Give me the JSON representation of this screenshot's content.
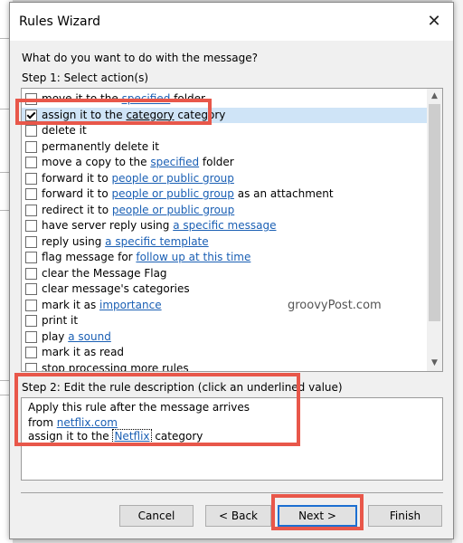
{
  "window": {
    "title": "Rules Wizard"
  },
  "question": "What do you want to do with the message?",
  "step1_label": "Step 1: Select action(s)",
  "actions": [
    {
      "parts": [
        {
          "t": "move it to the "
        },
        {
          "l": "specified"
        },
        {
          "t": " folder"
        }
      ],
      "checked": false,
      "selected": false
    },
    {
      "parts": [
        {
          "t": "assign it to the "
        },
        {
          "l": "category",
          "dark": true
        },
        {
          "t": " category"
        }
      ],
      "checked": true,
      "selected": true
    },
    {
      "parts": [
        {
          "t": "delete it"
        }
      ],
      "checked": false,
      "selected": false
    },
    {
      "parts": [
        {
          "t": "permanently delete it"
        }
      ],
      "checked": false,
      "selected": false
    },
    {
      "parts": [
        {
          "t": "move a copy to the "
        },
        {
          "l": "specified"
        },
        {
          "t": " folder"
        }
      ],
      "checked": false,
      "selected": false
    },
    {
      "parts": [
        {
          "t": "forward it to "
        },
        {
          "l": "people or public group"
        }
      ],
      "checked": false,
      "selected": false
    },
    {
      "parts": [
        {
          "t": "forward it to "
        },
        {
          "l": "people or public group"
        },
        {
          "t": " as an attachment"
        }
      ],
      "checked": false,
      "selected": false
    },
    {
      "parts": [
        {
          "t": "redirect it to "
        },
        {
          "l": "people or public group"
        }
      ],
      "checked": false,
      "selected": false
    },
    {
      "parts": [
        {
          "t": "have server reply using "
        },
        {
          "l": "a specific message"
        }
      ],
      "checked": false,
      "selected": false
    },
    {
      "parts": [
        {
          "t": "reply using "
        },
        {
          "l": "a specific template"
        }
      ],
      "checked": false,
      "selected": false
    },
    {
      "parts": [
        {
          "t": "flag message for "
        },
        {
          "l": "follow up at this time"
        }
      ],
      "checked": false,
      "selected": false
    },
    {
      "parts": [
        {
          "t": "clear the Message Flag"
        }
      ],
      "checked": false,
      "selected": false
    },
    {
      "parts": [
        {
          "t": "clear message's categories"
        }
      ],
      "checked": false,
      "selected": false
    },
    {
      "parts": [
        {
          "t": "mark it as "
        },
        {
          "l": "importance"
        }
      ],
      "checked": false,
      "selected": false
    },
    {
      "parts": [
        {
          "t": "print it"
        }
      ],
      "checked": false,
      "selected": false
    },
    {
      "parts": [
        {
          "t": "play "
        },
        {
          "l": "a sound"
        }
      ],
      "checked": false,
      "selected": false
    },
    {
      "parts": [
        {
          "t": "mark it as read"
        }
      ],
      "checked": false,
      "selected": false
    },
    {
      "parts": [
        {
          "t": "stop processing more rules"
        }
      ],
      "checked": false,
      "selected": false
    }
  ],
  "step2_label": "Step 2: Edit the rule description (click an underlined value)",
  "description": {
    "line1": "Apply this rule after the message arrives",
    "line2_prefix": "from ",
    "line2_link": "netflix.com",
    "line3_prefix": "assign it to the ",
    "line3_link": "Netflix",
    "line3_suffix": " category"
  },
  "buttons": {
    "cancel": "Cancel",
    "back": "< Back",
    "next": "Next >",
    "finish": "Finish"
  },
  "watermark": "groovyPost.com",
  "icons": {
    "close": "close-icon",
    "checkbox": "checkbox-icon",
    "scroll_up": "scroll-up-icon",
    "scroll_down": "scroll-down-icon"
  },
  "colors": {
    "link": "#1a5fb4",
    "highlight": "#e8574a",
    "selection": "#cfe4f7",
    "default_button_border": "#1c6fd1"
  }
}
